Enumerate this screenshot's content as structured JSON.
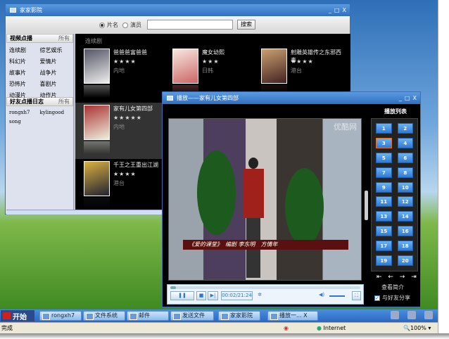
{
  "main_window": {
    "title": "家家影院",
    "controls": [
      "_",
      "□",
      "X"
    ],
    "search": {
      "option_title": "片名",
      "option_actor": "演员",
      "selected": "片名",
      "value": "",
      "button": "搜索"
    },
    "categories_header": "视频点播",
    "categories_all": "所有",
    "categories": [
      "连续剧",
      "综艺娱乐",
      "科幻片",
      "爱情片",
      "故事片",
      "战争片",
      "恐怖片",
      "喜剧片",
      "动漫片",
      "动作片"
    ],
    "friends_header": "好友点播日志",
    "friends_all": "所有",
    "friends": [
      "rongxh7",
      "kylingood",
      "song"
    ],
    "section": "连续剧",
    "movies": [
      {
        "title": "爸爸爸富爸爸",
        "stars": "★★★★",
        "region": "内地"
      },
      {
        "title": "魔女幼熙",
        "stars": "★★★",
        "region": "日韩"
      },
      {
        "title": "射雕英雄传之东邪西毒",
        "stars": "★★★★",
        "region": "港台"
      },
      {
        "title": "家有儿女第四部",
        "stars": "★★★★★",
        "region": "内地"
      },
      {
        "title": "千王之王重出江湖",
        "stars": "★★★★",
        "region": "港台"
      }
    ]
  },
  "player": {
    "title": "播放——家有儿女第四部",
    "controls": [
      "_",
      "□",
      "X"
    ],
    "watermark": "优酷网",
    "subtitle": "《爱的课堂》　编剧 李东明　方情年",
    "playlist_title": "播放列表",
    "episodes": [
      "1",
      "2",
      "3",
      "4",
      "5",
      "6",
      "7",
      "8",
      "9",
      "10",
      "11",
      "12",
      "13",
      "14",
      "15",
      "16",
      "17",
      "18",
      "19",
      "20"
    ],
    "selected_episode": "3",
    "nav": "⇤ ← → ⇥",
    "intro": "查看简介",
    "share": "与好友分享",
    "share_checked": true,
    "time": "00:02/21:24",
    "progress": 0.03,
    "volume": 0.9
  },
  "taskbar": {
    "start": "开始",
    "items": [
      "rongxh7",
      "文件系统",
      "邮件",
      "发送文件",
      "家家影院",
      "播放一...  X"
    ]
  },
  "statusbar": {
    "text": "完成",
    "zone": "Internet",
    "zoom": "100%"
  }
}
